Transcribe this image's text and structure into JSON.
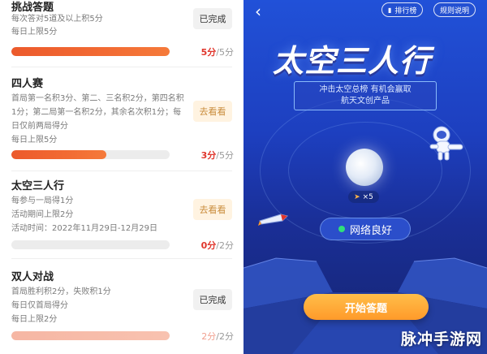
{
  "left": {
    "tasks": [
      {
        "title": "挑战答题",
        "lines": [
          "每次答对5道及以上积5分",
          "每日上限5分"
        ],
        "button": "已完成",
        "earned": "5分",
        "total": "/5分",
        "progress": 1.0
      },
      {
        "title": "四人赛",
        "lines": [
          "首局第一名积3分、第二、三名积2分，第四名积",
          "1分；第二局第一名积2分，其余名次积1分；每",
          "日仅前两局得分",
          "每日上限5分"
        ],
        "button": "去看看",
        "earned": "3分",
        "total": "/5分",
        "progress": 0.6
      },
      {
        "title": "太空三人行",
        "lines": [
          "每参与一局得1分",
          "活动期间上限2分",
          "活动时间：2022年11月29日-12月29日"
        ],
        "button": "去看看",
        "earned": "0分",
        "total": "/2分",
        "progress": 0.0
      },
      {
        "title": "双人对战",
        "lines": [
          "首局胜利积2分，失败积1分",
          "每日仅首局得分",
          "每日上限2分"
        ],
        "button": "已完成",
        "earned": "2分",
        "total": "/2分",
        "progress": 1.0
      }
    ]
  },
  "right": {
    "back_icon": "back-arrow-icon",
    "rank_label": "排行榜",
    "rules_label": "规则说明",
    "title": "太空三人行",
    "subtitle_line1": "冲击太空总榜 有机会赢取",
    "subtitle_line2": "航天文创产品",
    "rocket_count": "×5",
    "network_status": "网络良好",
    "start_button": "开始答题",
    "watermark": "脉冲手游网"
  },
  "colors": {
    "accent_red": "#e0352b",
    "progress_orange": "#f26b33",
    "network_green": "#2fe07a",
    "start_orange": "#ff9a2a",
    "space_blue": "#1d3fbf"
  }
}
